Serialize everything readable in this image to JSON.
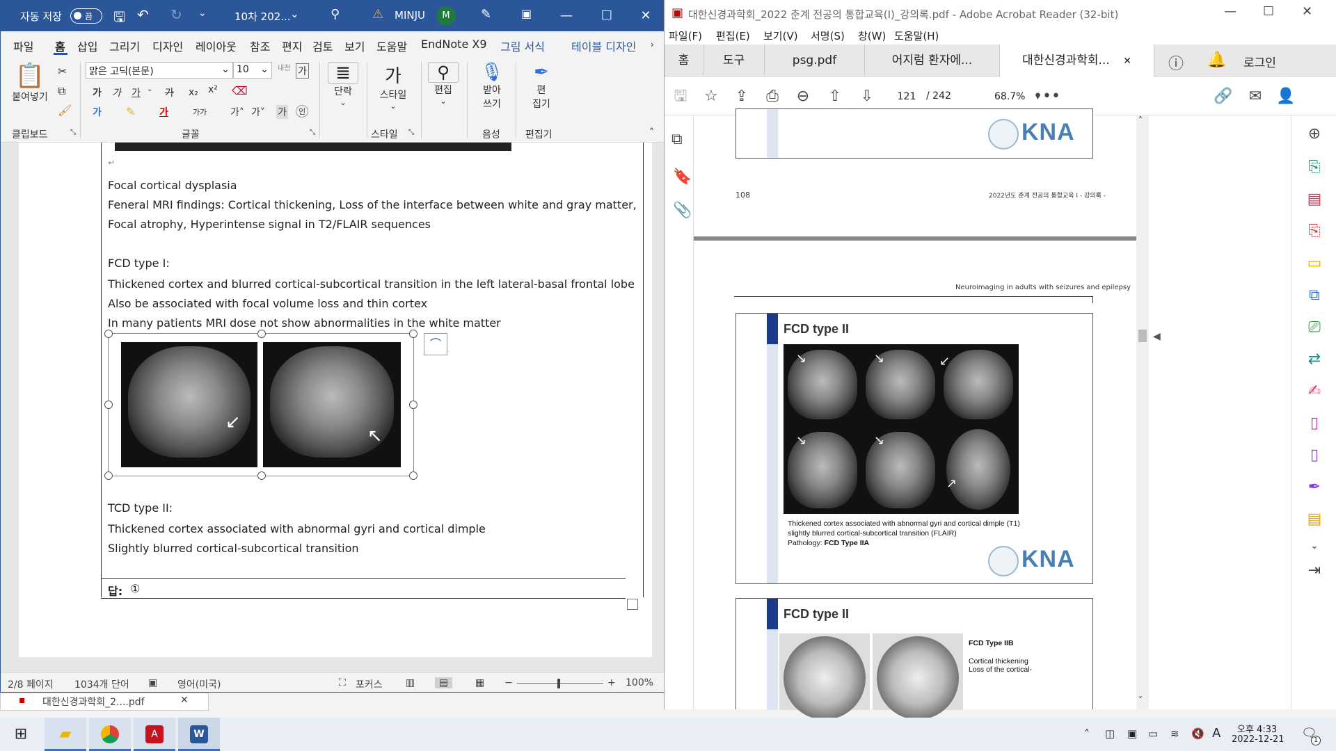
{
  "word": {
    "title_bar": {
      "autosave_label": "자동 저장",
      "autosave_state": "끔",
      "doc_title": "10차 202...",
      "user_name": "MINJU",
      "user_initial": "M"
    },
    "menu": [
      "파일",
      "홈",
      "삽입",
      "그리기",
      "디자인",
      "레이아웃",
      "참조",
      "편지",
      "검토",
      "보기",
      "도움말",
      "EndNote X9",
      "그림 서식",
      "테이블 디자인"
    ],
    "ribbon": {
      "paste_label": "붙여넣기",
      "clipboard_group": "클립보드",
      "font_name": "맑은 고딕(본문)",
      "font_size": "10",
      "font_group": "글꼴",
      "paragraph_label": "단락",
      "style_label": "스타일",
      "style_group": "스타일",
      "edit_label": "편집",
      "dictate_label_1": "받아",
      "dictate_label_2": "쓰기",
      "voice_group": "음성",
      "editor_label_1": "편",
      "editor_label_2": "집기",
      "editor_group": "편집기"
    },
    "document": {
      "lines": [
        "Focal cortical dysplasia",
        "Feneral MRI findings: Cortical thickening, Loss of the interface between white and gray matter,",
        "Focal atrophy, Hyperintense signal in T2/FLAIR sequences",
        "FCD type I:",
        "Thickened cortex and blurred cortical-subcortical transition in the left lateral-basal frontal lobe",
        "Also be associated with focal volume loss and thin cortex",
        "In many patients MRI dose not show abnormalities in the white matter",
        "TCD type II:",
        "Thickened cortex associated with abnormal gyri and cortical dimple",
        "Slightly blurred cortical-subcortical transition"
      ],
      "answer_label": "답:",
      "answer_value": "①"
    },
    "status": {
      "page": "2/8 페이지",
      "words": "1034개 단어",
      "language": "영어(미국)",
      "focus": "포커스",
      "zoom": "100%"
    },
    "taskbar_preview": "대한신경과학회_2....pdf"
  },
  "acrobat": {
    "title": "대한신경과학회_2022 춘계 전공의 통합교육(I)_강의록.pdf - Adobe Acrobat Reader (32-bit)",
    "menu": [
      "파일(F)",
      "편집(E)",
      "보기(V)",
      "서명(S)",
      "창(W)",
      "도움말(H)"
    ],
    "tabs": [
      "홈",
      "도구",
      "psg.pdf",
      "어지럼 환자에...",
      "대한신경과학회..."
    ],
    "login": "로그인",
    "page_current": "121",
    "page_total": "/ 242",
    "zoom": "68.7%",
    "page_footer_num": "108",
    "page_footer_text": "2022년도 춘계 전공의 통합교육 I  - 강의록 -",
    "header_right": "Neuroimaging in adults with seizures and epilepsy",
    "slide1": {
      "title": "FCD type II",
      "caption_1": "Thickened cortex associated with abnormal gyri and cortical dimple (T1)",
      "caption_2": "slightly blurred cortical-subcortical transition (FLAIR)",
      "caption_3_prefix": "Pathology: ",
      "caption_3_bold": "FCD Type IIA",
      "logo": "KNA"
    },
    "slide2": {
      "title": "FCD type II",
      "side_title": "FCD Type IIB",
      "side_line_1": "Cortical thickening",
      "side_line_2": "Loss of the cortical-"
    },
    "top_logo": "KNA"
  },
  "clock": {
    "time": "오후 4:33",
    "date": "2022-12-21"
  },
  "ime": "A",
  "notification_count": "1"
}
